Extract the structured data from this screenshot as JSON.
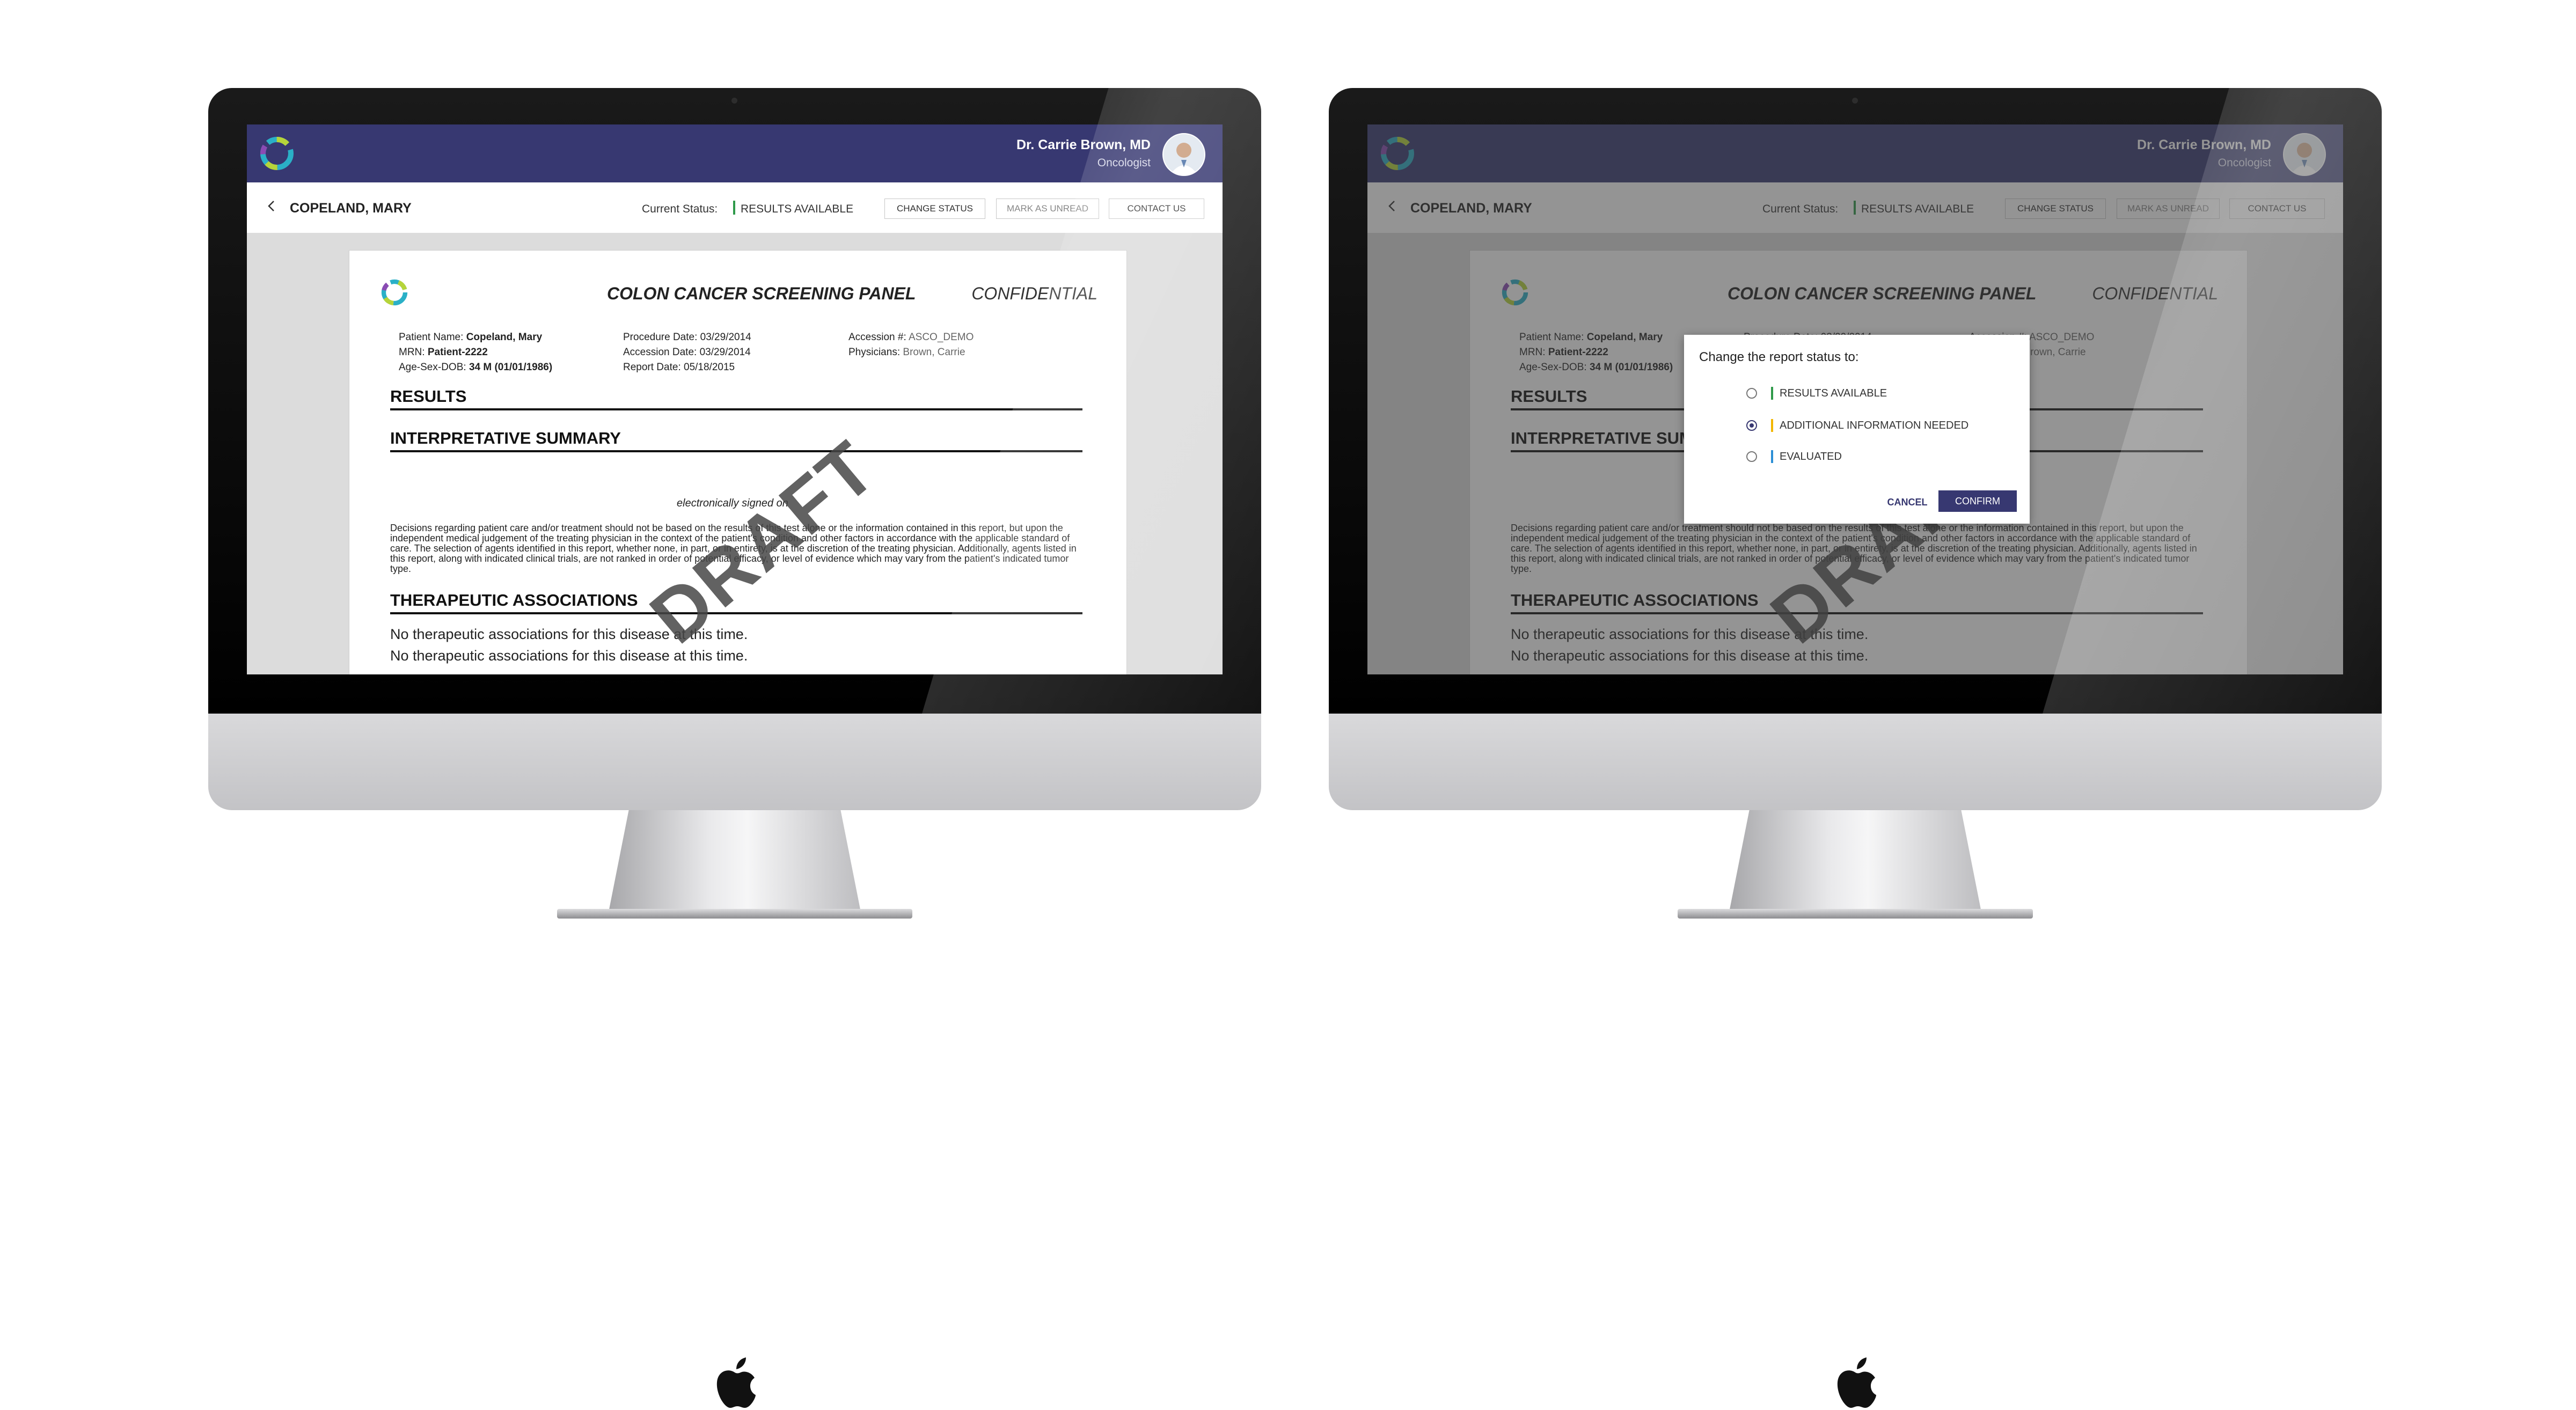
{
  "app": {
    "user_name": "Dr. Carrie Brown, MD",
    "user_role": "Oncologist"
  },
  "subheader": {
    "patient_title": "COPELAND, MARY",
    "status_label": "Current Status:",
    "status_value": "RESULTS AVAILABLE",
    "change_status": "CHANGE STATUS",
    "mark_unread": "MARK AS UNREAD",
    "contact_us": "CONTACT US"
  },
  "document": {
    "title": "COLON CANCER SCREENING PANEL",
    "confidential": "CONFIDENTIAL",
    "patient_name_label": "Patient Name:",
    "patient_name": "Copeland, Mary",
    "mrn_label": "MRN:",
    "mrn": "Patient-2222",
    "age_label": "Age-Sex-DOB:",
    "age": "34 M (01/01/1986)",
    "procedure_date": "Procedure Date: 03/29/2014",
    "accession_date": "Accession Date: 03/29/2014",
    "report_date": "Report Date: 05/18/2015",
    "accession_label": "Accession #:",
    "accession": "ASCO_DEMO",
    "physicians_label": "Physicians:",
    "physicians": "Brown, Carrie",
    "section_results": "RESULTS",
    "section_summary": "INTERPRETATIVE SUMMARY",
    "signed": "electronically signed on",
    "disclaimer": "Decisions regarding patient care and/or treatment should not be based on the results of this test alone or the information contained in this report, but upon the independent medical judgement of the treating physician in the context of the patient's condition and other factors in accordance with the applicable standard of care. The selection of agents identified in this report, whether none, in part, or in entirety, is at the discretion of the treating physician. Additionally, agents listed in this report, along with indicated clinical trials, are not ranked in order of potential efficacy, or level of evidence which may vary from the patient's indicated tumor type.",
    "section_therapy": "THERAPEUTIC ASSOCIATIONS",
    "therapy_lines": [
      "No therapeutic associations for this disease at this time.",
      "No therapeutic associations for this disease at this time."
    ],
    "watermark": "DRAFT"
  },
  "modal": {
    "title": "Change the report status to:",
    "options": [
      {
        "label": "RESULTS AVAILABLE",
        "color": "#2f9a4a",
        "selected": false
      },
      {
        "label": "ADDITIONAL INFORMATION NEEDED",
        "color": "#f2b600",
        "selected": true
      },
      {
        "label": "EVALUATED",
        "color": "#2c8fd6",
        "selected": false
      }
    ],
    "cancel": "CANCEL",
    "confirm": "CONFIRM"
  },
  "colors": {
    "header": "#373871",
    "status_green": "#2f9a4a",
    "status_yellow": "#f2b600",
    "status_blue": "#2c8fd6"
  }
}
